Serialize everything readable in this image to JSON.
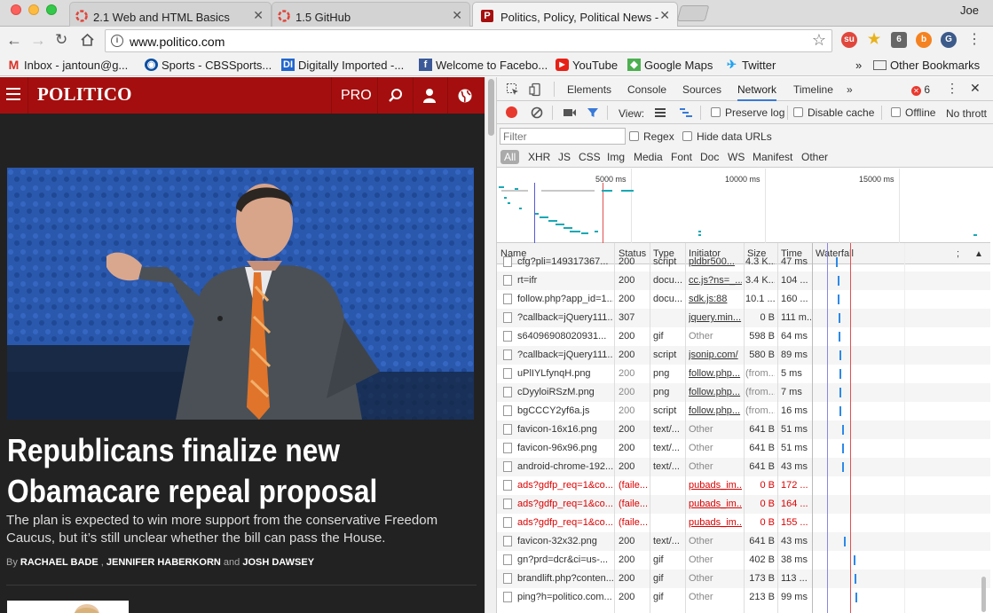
{
  "tabs": [
    {
      "title": "2.1 Web and HTML Basics"
    },
    {
      "title": "1.5 GitHub"
    },
    {
      "title": "Politics, Policy, Political News -"
    }
  ],
  "profile": "Joe",
  "address": {
    "url": "www.politico.com"
  },
  "bookmarks": [
    "Inbox - jantoun@g...",
    "Sports - CBSSports...",
    "Digitally Imported -...",
    "Welcome to Facebo...",
    "YouTube",
    "Google Maps",
    "Twitter",
    "Other Bookmarks"
  ],
  "extensions": {
    "badge": "6"
  },
  "site": {
    "logo": "POLITICO",
    "pro": "PRO",
    "headline": "Republicans finalize new Obamacare repeal proposal",
    "summary": "The plan is expected to win more support from the conservative Freedom Caucus, but it’s still unclear whether the bill can pass the House.",
    "by": "By",
    "author1": "RACHAEL BADE",
    "author2": "JENNIFER HABERKORN",
    "and": "and",
    "author3": "JOSH DAWSEY"
  },
  "devtools": {
    "tabs": [
      "Elements",
      "Console",
      "Sources",
      "Network",
      "Timeline"
    ],
    "error_count": "6",
    "view_label": "View:",
    "preserve_log": "Preserve log",
    "disable_cache": "Disable cache",
    "offline": "Offline",
    "throttle": "No thrott",
    "filter_placeholder": "Filter",
    "regex": "Regex",
    "hide_data_urls": "Hide data URLs",
    "types": [
      "All",
      "XHR",
      "JS",
      "CSS",
      "Img",
      "Media",
      "Font",
      "Doc",
      "WS",
      "Manifest",
      "Other"
    ],
    "overview_ticks": [
      "5000 ms",
      "10000 ms",
      "15000 ms"
    ],
    "columns": [
      "Name",
      "Status",
      "Type",
      "Initiator",
      "Size",
      "Time",
      "Waterfall"
    ],
    "rows": [
      {
        "name": "cfg?pli=149317367...",
        "status": "200",
        "type": "script",
        "initiator": "pldbr500...",
        "size": "4.3 K...",
        "time": "47 ms",
        "wf": 0.13,
        "err": false,
        "status_muted": false
      },
      {
        "name": "rt=ifr",
        "status": "200",
        "type": "docu...",
        "initiator": "cc.js?ns=_...",
        "size": "3.4 K...",
        "time": "104 ...",
        "wf": 0.14,
        "err": false,
        "status_muted": false
      },
      {
        "name": "follow.php?app_id=1...",
        "status": "200",
        "type": "docu...",
        "initiator": "sdk.js:88",
        "size": "10.1 ...",
        "time": "160 ...",
        "wf": 0.14,
        "err": false,
        "status_muted": false
      },
      {
        "name": "?callback=jQuery111...",
        "status": "307",
        "type": "",
        "initiator": "jquery.min...",
        "size": "0 B",
        "time": "111 m...",
        "wf": 0.145,
        "err": false,
        "status_muted": false
      },
      {
        "name": "s64096908020931...",
        "status": "200",
        "type": "gif",
        "initiator": "Other",
        "size": "598 B",
        "time": "64 ms",
        "wf": 0.145,
        "err": false,
        "status_muted": false
      },
      {
        "name": "?callback=jQuery111...",
        "status": "200",
        "type": "script",
        "initiator": "jsonip.com/",
        "size": "580 B",
        "time": "89 ms",
        "wf": 0.15,
        "err": false,
        "status_muted": false
      },
      {
        "name": "uPlIYLfynqH.png",
        "status": "200",
        "type": "png",
        "initiator": "follow.php...",
        "size": "(from...",
        "time": "5 ms",
        "wf": 0.15,
        "err": false,
        "status_muted": true
      },
      {
        "name": "cDyyloiRSzM.png",
        "status": "200",
        "type": "png",
        "initiator": "follow.php...",
        "size": "(from...",
        "time": "7 ms",
        "wf": 0.15,
        "err": false,
        "status_muted": true
      },
      {
        "name": "bgCCCY2yf6a.js",
        "status": "200",
        "type": "script",
        "initiator": "follow.php...",
        "size": "(from...",
        "time": "16 ms",
        "wf": 0.15,
        "err": false,
        "status_muted": true
      },
      {
        "name": "favicon-16x16.png",
        "status": "200",
        "type": "text/...",
        "initiator": "Other",
        "size": "641 B",
        "time": "51 ms",
        "wf": 0.165,
        "err": false,
        "status_muted": false
      },
      {
        "name": "favicon-96x96.png",
        "status": "200",
        "type": "text/...",
        "initiator": "Other",
        "size": "641 B",
        "time": "51 ms",
        "wf": 0.165,
        "err": false,
        "status_muted": false
      },
      {
        "name": "android-chrome-192...",
        "status": "200",
        "type": "text/...",
        "initiator": "Other",
        "size": "641 B",
        "time": "43 ms",
        "wf": 0.165,
        "err": false,
        "status_muted": false
      },
      {
        "name": "ads?gdfp_req=1&co...",
        "status": "(faile...",
        "type": "",
        "initiator": "pubads_im...",
        "size": "0 B",
        "time": "172 ...",
        "wf": -1,
        "err": true,
        "status_muted": false
      },
      {
        "name": "ads?gdfp_req=1&co...",
        "status": "(faile...",
        "type": "",
        "initiator": "pubads_im...",
        "size": "0 B",
        "time": "164 ...",
        "wf": -1,
        "err": true,
        "status_muted": false
      },
      {
        "name": "ads?gdfp_req=1&co...",
        "status": "(faile...",
        "type": "",
        "initiator": "pubads_im...",
        "size": "0 B",
        "time": "155 ...",
        "wf": -1,
        "err": true,
        "status_muted": false
      },
      {
        "name": "favicon-32x32.png",
        "status": "200",
        "type": "text/...",
        "initiator": "Other",
        "size": "641 B",
        "time": "43 ms",
        "wf": 0.175,
        "err": false,
        "status_muted": false
      },
      {
        "name": "gn?prd=dcr&ci=us-...",
        "status": "200",
        "type": "gif",
        "initiator": "Other",
        "size": "402 B",
        "time": "38 ms",
        "wf": 0.23,
        "err": false,
        "status_muted": false
      },
      {
        "name": "brandlift.php?conten...",
        "status": "200",
        "type": "gif",
        "initiator": "Other",
        "size": "173 B",
        "time": "113 ...",
        "wf": 0.235,
        "err": false,
        "status_muted": false
      },
      {
        "name": "ping?h=politico.com...",
        "status": "200",
        "type": "gif",
        "initiator": "Other",
        "size": "213 B",
        "time": "99 ms",
        "wf": 0.24,
        "err": false,
        "status_muted": false
      }
    ]
  },
  "colors": {
    "politico_red": "#a50e0e",
    "devtools_accent": "#3879d9",
    "waterfall_bar": "#2c89e8",
    "error_red": "#d00000"
  }
}
